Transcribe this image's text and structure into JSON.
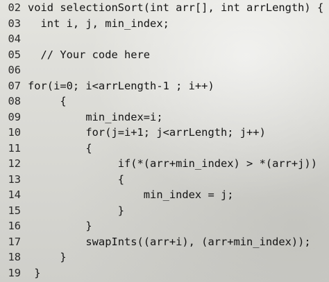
{
  "editor": {
    "lines": [
      {
        "no": "02",
        "text": "void selectionSort(int arr[], int arrLength) {"
      },
      {
        "no": "03",
        "text": "  int i, j, min_index;"
      },
      {
        "no": "04",
        "text": ""
      },
      {
        "no": "05",
        "text": "  // Your code here"
      },
      {
        "no": "06",
        "text": ""
      },
      {
        "no": "07",
        "text": "for(i=0; i<arrLength-1 ; i++)"
      },
      {
        "no": "08",
        "text": "     {"
      },
      {
        "no": "09",
        "text": "         min_index=i;"
      },
      {
        "no": "10",
        "text": "         for(j=i+1; j<arrLength; j++)"
      },
      {
        "no": "11",
        "text": "         {"
      },
      {
        "no": "12",
        "text": "              if(*(arr+min_index) > *(arr+j))"
      },
      {
        "no": "13",
        "text": "              {"
      },
      {
        "no": "14",
        "text": "                  min_index = j;"
      },
      {
        "no": "15",
        "text": "              }"
      },
      {
        "no": "16",
        "text": "         }"
      },
      {
        "no": "17",
        "text": "         swapInts((arr+i), (arr+min_index));"
      },
      {
        "no": "18",
        "text": "     }"
      },
      {
        "no": "19",
        "text": " }"
      }
    ]
  }
}
